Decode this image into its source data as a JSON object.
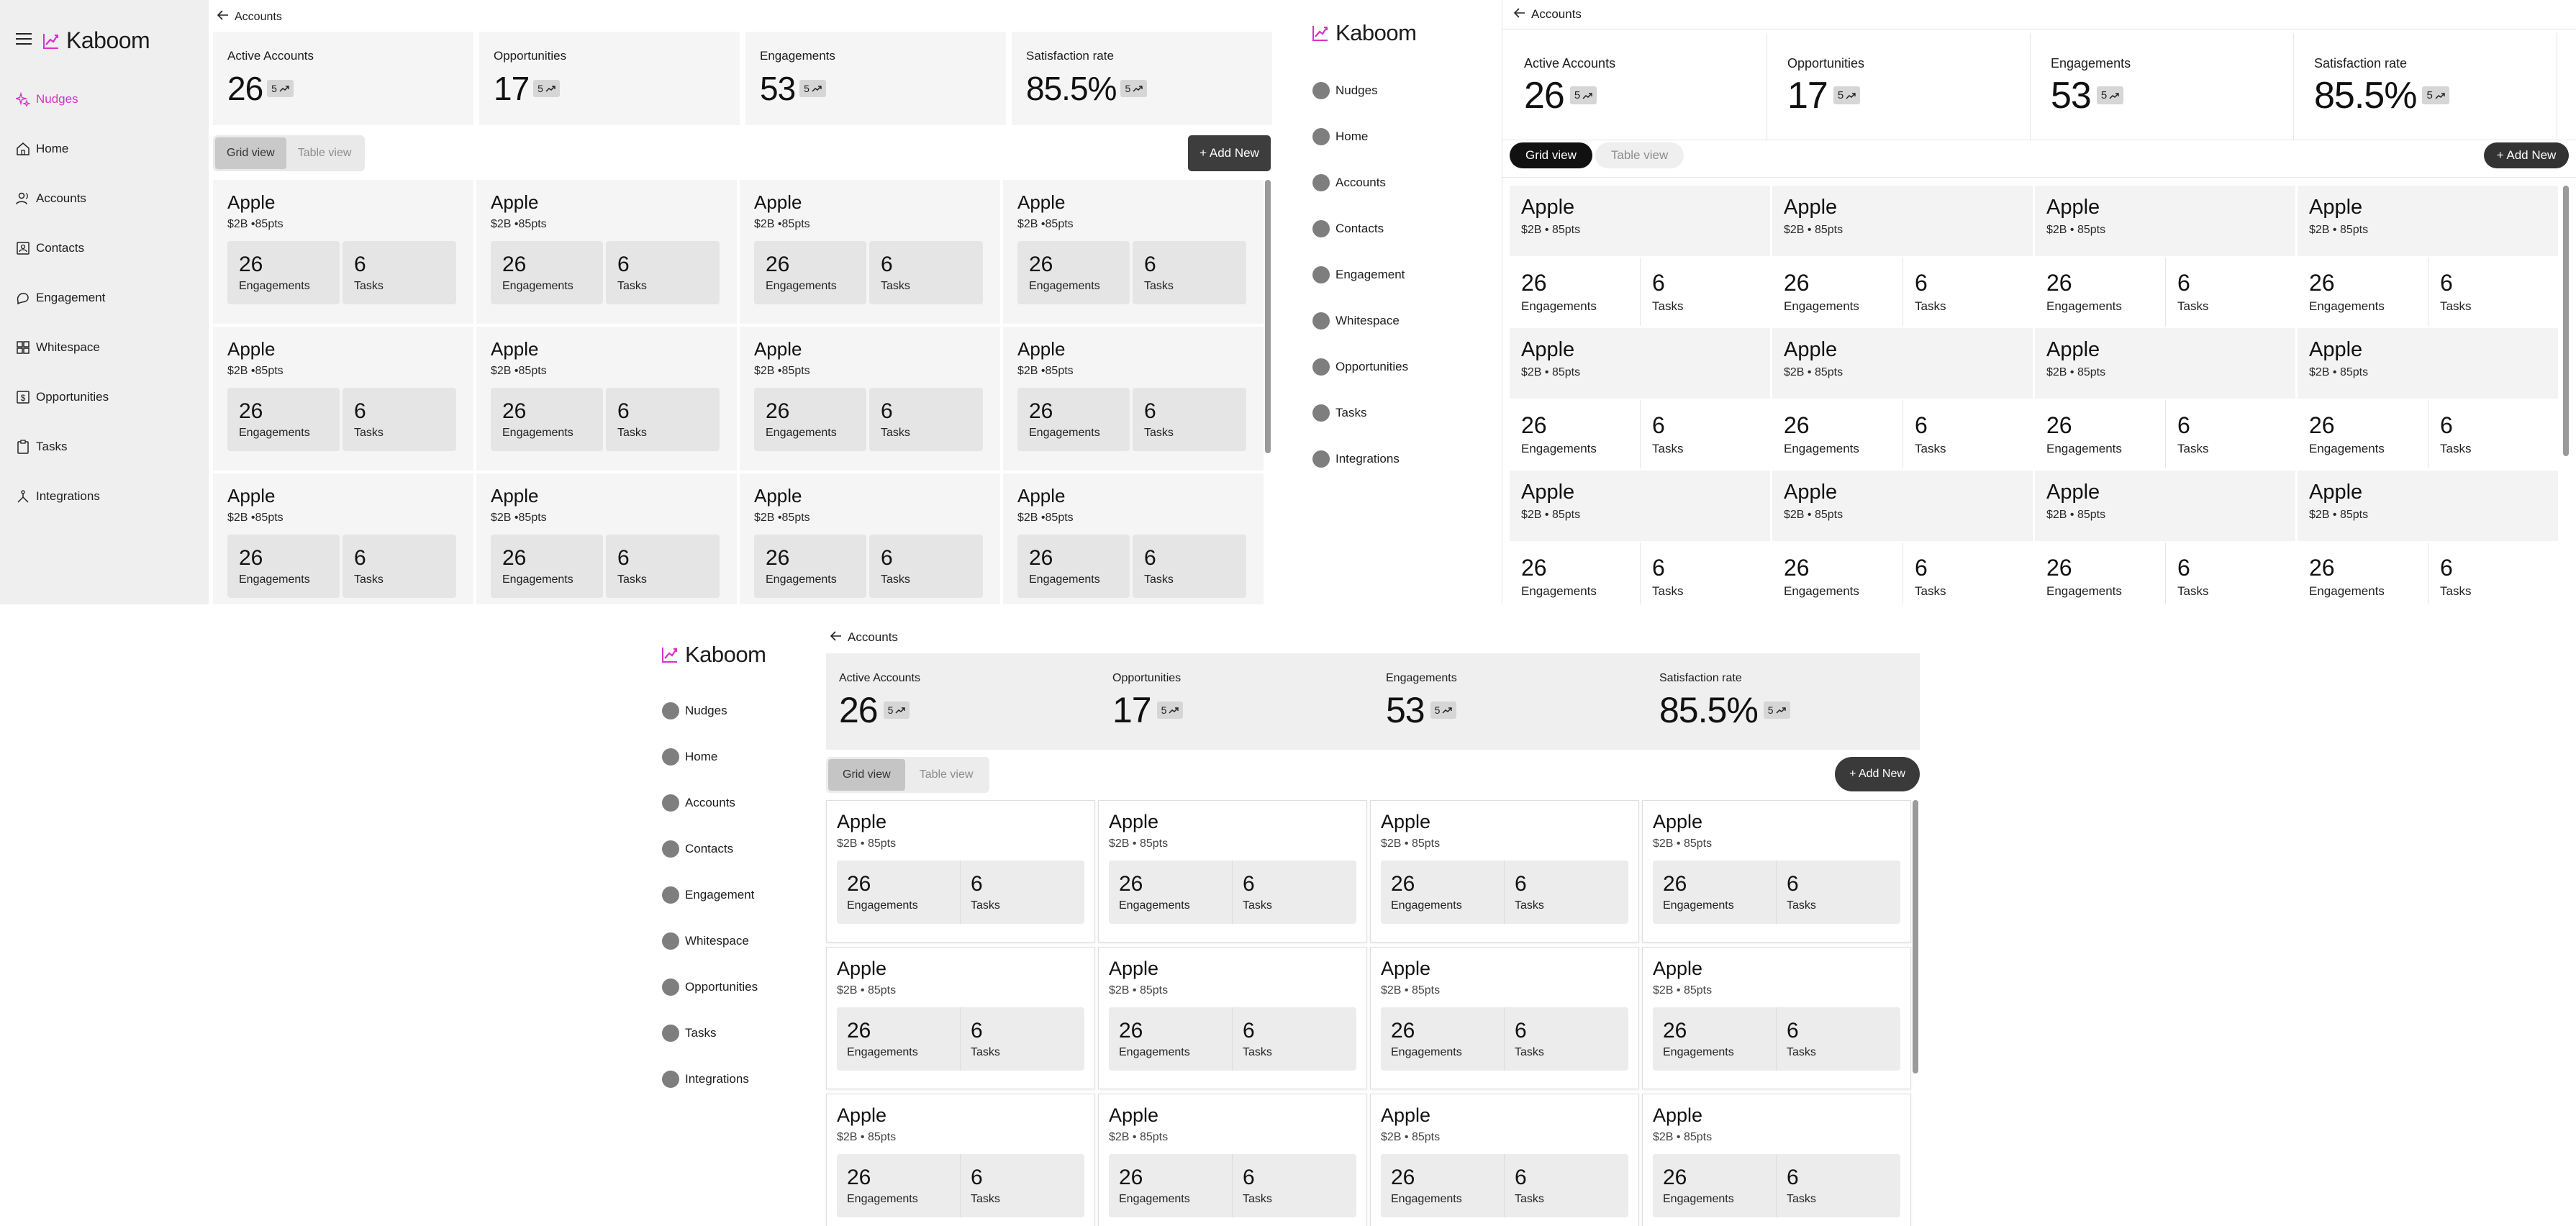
{
  "brand": {
    "name": "Kaboom",
    "accent_color": "#d633c6"
  },
  "breadcrumb": {
    "back_icon": "arrow-left-icon",
    "label": "Accounts"
  },
  "nav": {
    "with_nudges": [
      {
        "id": "nudges",
        "label": "Nudges",
        "icon": "sparkle-icon"
      },
      {
        "id": "home",
        "label": "Home",
        "icon": "home-icon"
      },
      {
        "id": "accounts",
        "label": "Accounts",
        "icon": "users-icon"
      },
      {
        "id": "contacts",
        "label": "Contacts",
        "icon": "contact-card-icon"
      },
      {
        "id": "engagement",
        "label": "Engagement",
        "icon": "chat-icon"
      },
      {
        "id": "whitespace",
        "label": "Whitespace",
        "icon": "grid-icon"
      },
      {
        "id": "opportunities",
        "label": "Opportunities",
        "icon": "dollar-icon"
      },
      {
        "id": "tasks",
        "label": "Tasks",
        "icon": "clipboard-icon"
      },
      {
        "id": "integrations",
        "label": "Integrations",
        "icon": "integrations-icon"
      }
    ]
  },
  "stats": [
    {
      "label": "Active Accounts",
      "value": "26",
      "badge": "5",
      "icon": "trend-up-icon"
    },
    {
      "label": "Opportunities",
      "value": "17",
      "badge": "5",
      "icon": "trend-up-icon"
    },
    {
      "label": "Engagements",
      "value": "53",
      "badge": "5",
      "icon": "trend-up-icon"
    },
    {
      "label": "Satisfaction rate",
      "value": "85.5%",
      "badge": "5",
      "icon": "trend-up-icon"
    }
  ],
  "view_toggle": {
    "grid": "Grid view",
    "table": "Table view"
  },
  "add_button": "+ Add New",
  "card": {
    "title": "Apple",
    "subtitle_a": "$2B •85pts",
    "subtitle_b": "$2B • 85pts",
    "engagements_value": "26",
    "engagements_label": "Engagements",
    "tasks_value": "6",
    "tasks_label": "Tasks"
  }
}
